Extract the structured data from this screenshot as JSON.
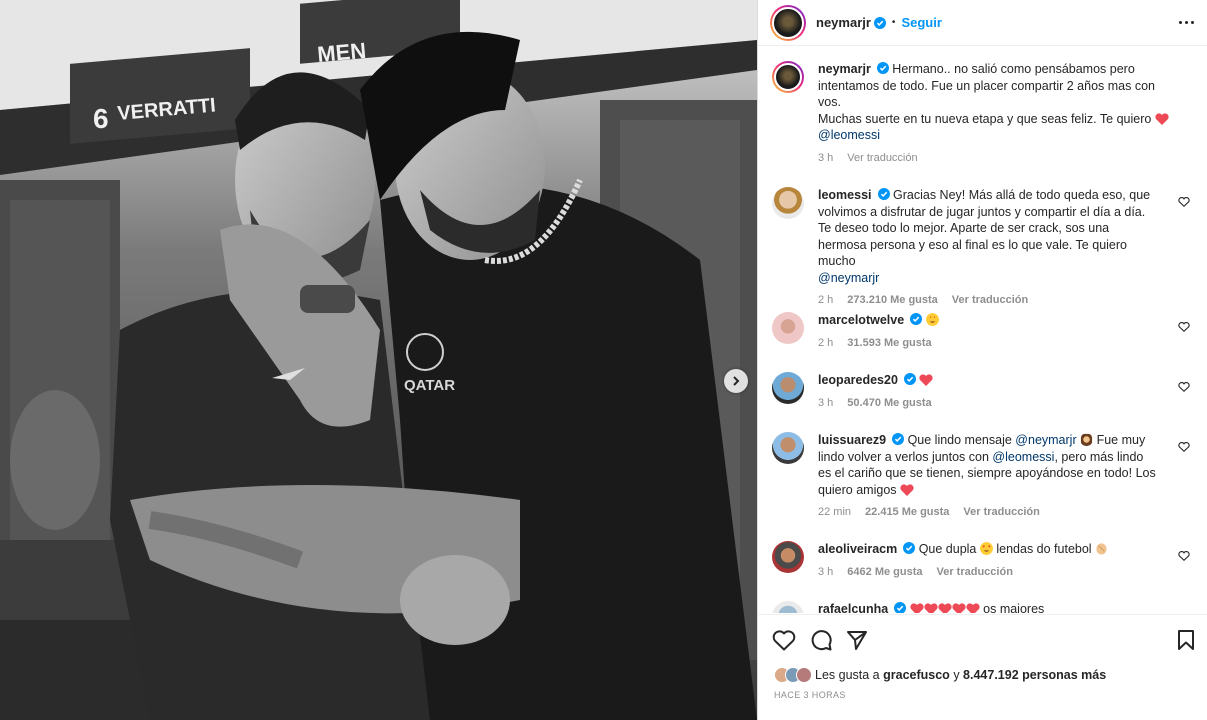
{
  "photo": {
    "jersey_name": "VERRATTI",
    "jersey_number": "6",
    "jersey_partial": "MEN",
    "shirt_sponsor": "QATAR"
  },
  "post": {
    "username": "neymarjr",
    "separator": "•",
    "follow_label": "Seguir"
  },
  "caption": {
    "username": "neymarjr",
    "line1": "Hermano.. no salió como pensábamos pero intentamos de todo. Fue un placer compartir 2 años mas con vos.",
    "line2": "Muchas suerte en tu nueva etapa y que seas feliz. Te quiero",
    "mention": "@leomessi",
    "time": "3 h",
    "translate": "Ver traducción"
  },
  "comments": [
    {
      "username": "leomessi",
      "text": "Gracias Ney! Más allá de todo queda eso, que volvimos a disfrutar de jugar juntos y compartir el día a día. Te deseo todo lo mejor. Aparte de ser crack, sos una hermosa persona y eso al final es lo que vale. Te quiero mucho",
      "mention": "@neymarjr",
      "time": "2 h",
      "likes": "273.210 Me gusta",
      "translate": "Ver traducción"
    },
    {
      "username": "marcelotwelve",
      "time": "2 h",
      "likes": "31.593 Me gusta"
    },
    {
      "username": "leoparedes20",
      "time": "3 h",
      "likes": "50.470 Me gusta"
    },
    {
      "username": "luissuarez9",
      "text_a": "Que lindo mensaje",
      "mention_a": "@neymarjr",
      "text_b": "Fue muy lindo volver a verlos juntos con",
      "mention_b": "@leomessi",
      "text_c": ", pero más lindo es el cariño que se tienen, siempre apoyándose en todo! Los quiero amigos",
      "time": "22 min",
      "likes": "22.415 Me gusta",
      "translate": "Ver traducción"
    },
    {
      "username": "aleoliveiracm",
      "text_a": "Que dupla",
      "text_b": "lendas do futebol",
      "time": "3 h",
      "likes": "6462 Me gusta",
      "translate": "Ver traducción"
    },
    {
      "username": "rafaelcunha",
      "text": "os maiores"
    }
  ],
  "likes_bar": {
    "prefix": "Les gusta a",
    "user": "gracefusco",
    "conj": "y",
    "others": "8.447.192 personas más"
  },
  "time_ago": "HACE 3 HORAS",
  "colors": {
    "follow": "#0095f6",
    "mention": "#00376b",
    "meta": "#8e8e8e",
    "heart": "#ed4956"
  }
}
